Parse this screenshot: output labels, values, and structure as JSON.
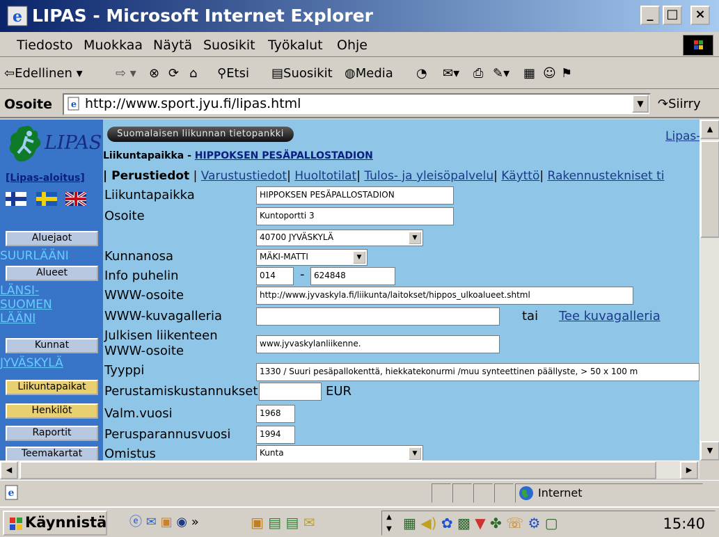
{
  "window": {
    "title": "LIPAS - Microsoft Internet Explorer",
    "min": "_",
    "max": "□",
    "close": "×"
  },
  "menu": {
    "items": [
      "Tiedosto",
      "Muokkaa",
      "Näytä",
      "Suosikit",
      "Työkalut",
      "Ohje"
    ]
  },
  "toolbar": {
    "back": "Edellinen",
    "search": "Etsi",
    "favorites": "Suosikit",
    "media": "Media"
  },
  "address": {
    "label": "Osoite",
    "url": "http://www.sport.jyu.fi/lipas.html",
    "go": "Siirry"
  },
  "leftnav": {
    "logo_text": "LIPAS",
    "start_link": "[Lipas-aloitus]",
    "btn_aluejaot": "Aluejaot",
    "txt_suurlaani": "SUURLÄÄNI",
    "btn_alueet": "Alueet",
    "lnk_lansi1": "LÄNSI-",
    "lnk_lansi2": "SUOMEN",
    "lnk_lansi3": "LÄÄNI",
    "btn_kunnat": "Kunnat",
    "lnk_jyvaskyla": "JYVÄSKYLÄ",
    "btn_liikuntapaikat": "Liikuntapaikat",
    "btn_henkilot": "Henkilöt",
    "btn_raportit": "Raportit",
    "btn_teemakartat": "Teemakartat"
  },
  "main": {
    "banner": "Suomalaisen liikunnan tietopankki",
    "top_right_link": "Lipas-",
    "heading_prefix": "Liikuntapaikka - ",
    "heading_link": "HIPPOKSEN PESÄPALLOSTADION",
    "tabs": {
      "active": "| Perustiedot",
      "t1": "Varustustiedot",
      "t2": "Huoltotilat",
      "t3": "Tulos- ja yleisöpalvelu",
      "t4": "Käyttö",
      "t5": "Rakennustekniset ti",
      "sep": "|"
    },
    "form": {
      "l_liikuntapaikka": "Liikuntapaikka",
      "v_liikuntapaikka": "HIPPOKSEN PESÄPALLOSTADION",
      "l_osoite": "Osoite",
      "v_osoite": "Kuntoportti 3",
      "v_postinumero": "40700 JYVÄSKYLÄ",
      "l_kunnanosa": "Kunnanosa",
      "v_kunnanosa": "MÄKI-MATTI",
      "l_info": "Info puhelin",
      "v_info1": "014",
      "v_info_dash": "-",
      "v_info2": "624848",
      "l_www": "WWW-osoite",
      "v_www": "http://www.jyvaskyla.fi/liikunta/laitokset/hippos_ulkoalueet.shtml",
      "l_kuvagalleria": "WWW-kuvagalleria",
      "v_kuvagalleria": "",
      "tai": "tai",
      "tee_kuvagalleria": "Tee kuvagalleria",
      "l_julkisen1": "Julkisen liikenteen",
      "l_julkisen2": "WWW-osoite",
      "v_julkisen": "www.jyvaskylanliikenne.",
      "l_tyyppi": "Tyyppi",
      "v_tyyppi": "1330 / Suuri pesäpallokenttä, hiekkatekonurmi /muu synteettinen päällyste, > 50 x 100 m",
      "l_perustamis": "Perustamiskustannukset",
      "v_perustamis": "",
      "eur": "EUR",
      "l_valm": "Valm.vuosi",
      "v_valm": "1968",
      "l_perusparannus": "Perusparannusvuosi",
      "v_perusparannus": "1994",
      "l_omistus": "Omistus",
      "v_omistus": "Kunta"
    }
  },
  "status": {
    "zone": "Internet"
  },
  "taskbar": {
    "start": "Käynnistä",
    "clock": "15:40"
  }
}
